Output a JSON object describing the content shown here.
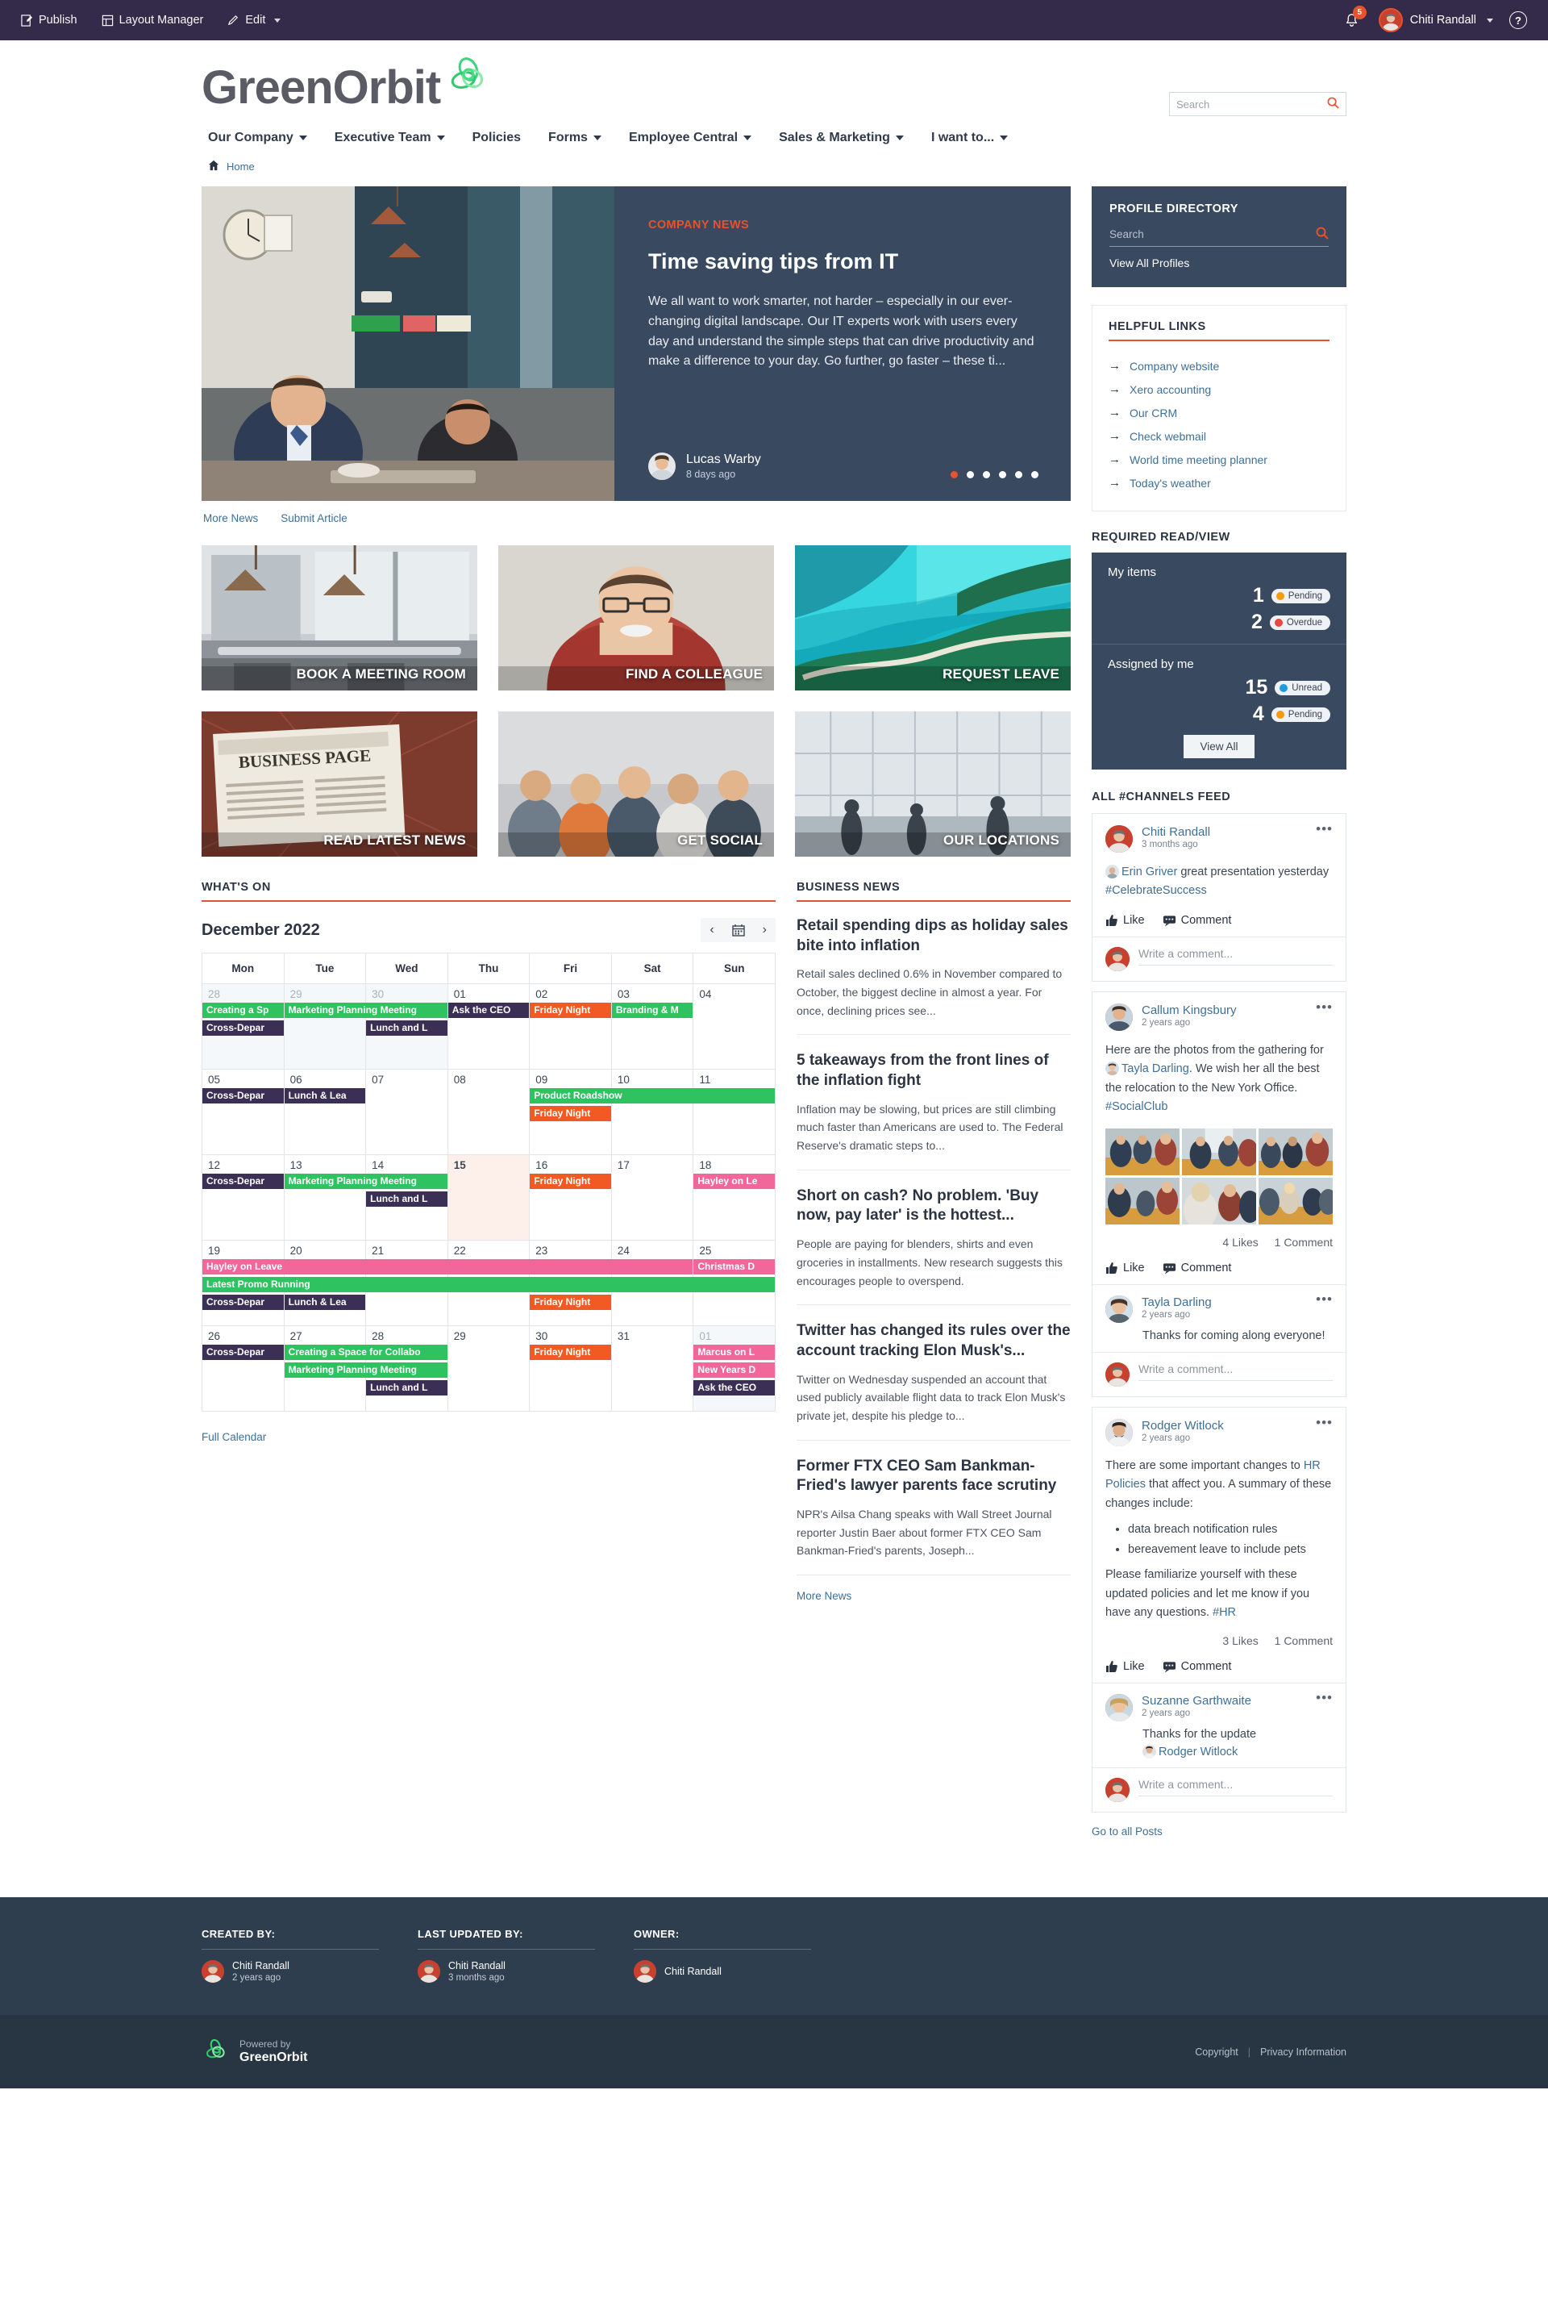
{
  "admin_bar": {
    "publish": "Publish",
    "layout_manager": "Layout Manager",
    "edit": "Edit",
    "notification_count": "5",
    "user_name": "Chiti Randall",
    "help": "?"
  },
  "header": {
    "logo_text": "GreenOrbit",
    "search_placeholder": "Search"
  },
  "nav": {
    "items": [
      {
        "label": "Our Company",
        "caret": true
      },
      {
        "label": "Executive Team",
        "caret": true
      },
      {
        "label": "Policies",
        "caret": false
      },
      {
        "label": "Forms",
        "caret": true
      },
      {
        "label": "Employee Central",
        "caret": true
      },
      {
        "label": "Sales & Marketing",
        "caret": true
      },
      {
        "label": "I want to...",
        "caret": true
      }
    ]
  },
  "breadcrumb": {
    "home": "Home"
  },
  "hero": {
    "kicker": "COMPANY NEWS",
    "title": "Time saving tips from IT",
    "body": "We all want to work smarter, not harder – especially in our ever-changing digital landscape. Our IT experts work with users every day and understand the simple steps that can drive productivity and make a difference to your day. Go further, go faster – these ti...",
    "author": "Lucas Warby",
    "time": "8 days ago",
    "dots_total": 6,
    "dot_active": 0,
    "more_news": "More News",
    "submit_article": "Submit Article"
  },
  "tiles": [
    {
      "label": "BOOK A MEETING ROOM",
      "name": "tile-book-a-meeting-room"
    },
    {
      "label": "FIND A COLLEAGUE",
      "name": "tile-find-a-colleague"
    },
    {
      "label": "REQUEST LEAVE",
      "name": "tile-request-leave"
    },
    {
      "label": "READ LATEST NEWS",
      "name": "tile-read-latest-news"
    },
    {
      "label": "GET SOCIAL",
      "name": "tile-get-social"
    },
    {
      "label": "OUR LOCATIONS",
      "name": "tile-our-locations"
    }
  ],
  "calendar": {
    "widget_title": "WHAT'S ON",
    "month": "December 2022",
    "prev": "‹",
    "next": "›",
    "daynames": [
      "Mon",
      "Tue",
      "Wed",
      "Thu",
      "Fri",
      "Sat",
      "Sun"
    ],
    "full_calendar": "Full Calendar",
    "weeks": [
      [
        {
          "num": "28",
          "muted": true,
          "events": [
            {
              "t": "Creating a Sp",
              "c": "green"
            },
            {
              "t": "Cross-Depar",
              "c": "purple"
            }
          ]
        },
        {
          "num": "29",
          "muted": true,
          "events": [
            {
              "t": "Marketing Planning Meeting",
              "c": "green",
              "span": 2
            }
          ]
        },
        {
          "num": "30",
          "muted": true,
          "events": [
            {
              "t": "",
              "c": "spacer"
            },
            {
              "t": "Lunch and L",
              "c": "purple"
            }
          ]
        },
        {
          "num": "01",
          "muted": false,
          "events": [
            {
              "t": "Ask the CEO",
              "c": "purple"
            }
          ]
        },
        {
          "num": "02",
          "muted": false,
          "events": [
            {
              "t": "Friday Night",
              "c": "orange"
            }
          ]
        },
        {
          "num": "03",
          "muted": false,
          "events": [
            {
              "t": "Branding & M",
              "c": "green"
            }
          ]
        },
        {
          "num": "04",
          "muted": false,
          "events": []
        }
      ],
      [
        {
          "num": "05",
          "muted": false,
          "events": [
            {
              "t": "Cross-Depar",
              "c": "purple"
            }
          ]
        },
        {
          "num": "06",
          "muted": false,
          "events": [
            {
              "t": "Lunch & Lea",
              "c": "purple"
            }
          ]
        },
        {
          "num": "07",
          "muted": false,
          "events": []
        },
        {
          "num": "08",
          "muted": false,
          "events": []
        },
        {
          "num": "09",
          "muted": false,
          "events": [
            {
              "t": "Product Roadshow",
              "c": "green",
              "span": 3
            },
            {
              "t": "Friday Night",
              "c": "orange"
            }
          ]
        },
        {
          "num": "10",
          "muted": false,
          "events": []
        },
        {
          "num": "11",
          "muted": false,
          "events": []
        }
      ],
      [
        {
          "num": "12",
          "muted": false,
          "events": [
            {
              "t": "Cross-Depar",
              "c": "purple"
            }
          ]
        },
        {
          "num": "13",
          "muted": false,
          "events": [
            {
              "t": "Marketing Planning Meeting",
              "c": "green",
              "span": 2
            }
          ]
        },
        {
          "num": "14",
          "muted": false,
          "events": [
            {
              "t": "",
              "c": "spacer"
            },
            {
              "t": "Lunch and L",
              "c": "purple"
            }
          ]
        },
        {
          "num": "15",
          "muted": false,
          "today": true,
          "events": []
        },
        {
          "num": "16",
          "muted": false,
          "events": [
            {
              "t": "Friday Night",
              "c": "orange"
            }
          ]
        },
        {
          "num": "17",
          "muted": false,
          "events": []
        },
        {
          "num": "18",
          "muted": false,
          "events": [
            {
              "t": "Hayley on Le",
              "c": "pink"
            }
          ]
        }
      ],
      [
        {
          "num": "19",
          "muted": false,
          "events": [
            {
              "t": "Hayley on Leave",
              "c": "pink",
              "span": 6
            },
            {
              "t": "Latest Promo Running",
              "c": "green",
              "span": 7
            },
            {
              "t": "Cross-Depar",
              "c": "purple"
            }
          ]
        },
        {
          "num": "20",
          "muted": false,
          "events": [
            {
              "t": "",
              "c": "spacer"
            },
            {
              "t": "",
              "c": "spacer"
            },
            {
              "t": "Lunch & Lea",
              "c": "purple"
            }
          ]
        },
        {
          "num": "21",
          "muted": false,
          "events": []
        },
        {
          "num": "22",
          "muted": false,
          "events": []
        },
        {
          "num": "23",
          "muted": false,
          "events": [
            {
              "t": "",
              "c": "spacer"
            },
            {
              "t": "",
              "c": "spacer"
            },
            {
              "t": "Friday Night",
              "c": "orange"
            }
          ]
        },
        {
          "num": "24",
          "muted": false,
          "events": []
        },
        {
          "num": "25",
          "muted": false,
          "events": [
            {
              "t": "Christmas D",
              "c": "pink"
            }
          ]
        }
      ],
      [
        {
          "num": "26",
          "muted": false,
          "events": [
            {
              "t": "Cross-Depar",
              "c": "purple"
            }
          ]
        },
        {
          "num": "27",
          "muted": false,
          "events": [
            {
              "t": "Creating a Space for Collabo",
              "c": "green",
              "span": 2
            },
            {
              "t": "Marketing Planning Meeting",
              "c": "green",
              "span": 2
            }
          ]
        },
        {
          "num": "28",
          "muted": false,
          "events": [
            {
              "t": "",
              "c": "spacer"
            },
            {
              "t": "",
              "c": "spacer"
            },
            {
              "t": "Lunch and L",
              "c": "purple"
            }
          ]
        },
        {
          "num": "29",
          "muted": false,
          "events": []
        },
        {
          "num": "30",
          "muted": false,
          "events": [
            {
              "t": "Friday Night",
              "c": "orange"
            }
          ]
        },
        {
          "num": "31",
          "muted": false,
          "events": []
        },
        {
          "num": "01",
          "muted": true,
          "events": [
            {
              "t": "Marcus on L",
              "c": "pink"
            },
            {
              "t": "New Years D",
              "c": "pink"
            },
            {
              "t": "Ask the CEO",
              "c": "purple"
            }
          ]
        }
      ]
    ]
  },
  "business_news": {
    "widget_title": "BUSINESS NEWS",
    "more": "More News",
    "items": [
      {
        "title": "Retail spending dips as holiday sales bite into inflation",
        "snippet": "Retail sales declined 0.6% in November compared to October, the biggest decline in almost a year. For once, declining prices see..."
      },
      {
        "title": "5 takeaways from the front lines of the inflation fight",
        "snippet": "Inflation may be slowing, but prices are still climbing much faster than Americans are used to. The Federal Reserve's dramatic steps to..."
      },
      {
        "title": "Short on cash? No problem. 'Buy now, pay later' is the hottest...",
        "snippet": "People are paying for blenders, shirts and even groceries in installments. New research suggests this encourages people to overspend."
      },
      {
        "title": "Twitter has changed its rules over the account tracking Elon Musk's...",
        "snippet": "Twitter on Wednesday suspended an account that used publicly available flight data to track Elon Musk's private jet, despite his pledge to..."
      },
      {
        "title": "Former FTX CEO Sam Bankman-Fried's lawyer parents face scrutiny",
        "snippet": "NPR's Ailsa Chang speaks with Wall Street Journal reporter Justin Baer about former FTX CEO Sam Bankman-Fried's parents, Joseph..."
      }
    ]
  },
  "profile_directory": {
    "title": "PROFILE DIRECTORY",
    "search_placeholder": "Search",
    "view_all": "View All Profiles"
  },
  "helpful_links": {
    "title": "HELPFUL LINKS",
    "items": [
      "Company website",
      "Xero accounting",
      "Our CRM",
      "Check webmail",
      "World time meeting planner",
      "Today's weather"
    ]
  },
  "required_read": {
    "title": "REQUIRED READ/VIEW",
    "my_items_label": "My items",
    "my_items": [
      {
        "count": "1",
        "status": "Pending",
        "color": "#f59b11"
      },
      {
        "count": "2",
        "status": "Overdue",
        "color": "#e8483f"
      }
    ],
    "assigned_label": "Assigned by me",
    "assigned": [
      {
        "count": "15",
        "status": "Unread",
        "color": "#1f9bde"
      },
      {
        "count": "4",
        "status": "Pending",
        "color": "#f59b11"
      }
    ],
    "view_all": "View All"
  },
  "feed": {
    "title": "ALL #CHANNELS FEED",
    "like_label": "Like",
    "comment_label": "Comment",
    "comment_placeholder": "Write a comment...",
    "goto_all": "Go to all Posts",
    "posts": [
      {
        "author": "Chiti Randall",
        "time": "3 months ago",
        "mention": "Erin Griver",
        "body_after": " great presentation yesterday ",
        "hashtag": "#CelebrateSuccess",
        "menu": "•••"
      },
      {
        "author": "Callum Kingsbury",
        "time": "2 years ago",
        "body_pre": "Here are the photos from the gathering for ",
        "mention": "Tayla Darling",
        "body_after": ". We wish her all the best the relocation to the New York Office. ",
        "hashtag": "#SocialClub",
        "likes": "4 Likes",
        "comments": "1 Comment",
        "comment_author": "Tayla Darling",
        "comment_time": "2 years ago",
        "comment_text": "Thanks for coming along everyone!",
        "menu": "•••"
      },
      {
        "author": "Rodger Witlock",
        "time": "2 years ago",
        "body_pre": "There are some important changes to ",
        "link": "HR Policies",
        "body_after": " that affect you. A summary of these changes include:",
        "bullets": [
          "data breach notification rules",
          "bereavement leave to include pets"
        ],
        "body_tail": "Please familiarize yourself with these updated policies and let me know if you have any questions. ",
        "hashtag": "#HR",
        "likes": "3 Likes",
        "comments": "1 Comment",
        "comment_author": "Suzanne Garthwaite",
        "comment_time": "2 years ago",
        "comment_text": "Thanks for the update",
        "comment_mention": "Rodger Witlock",
        "menu": "•••"
      }
    ]
  },
  "footer": {
    "created_by_label": "CREATED BY:",
    "created_by_name": "Chiti Randall",
    "created_by_time": "2 years ago",
    "last_updated_label": "LAST UPDATED BY:",
    "last_updated_name": "Chiti Randall",
    "last_updated_time": "3 months ago",
    "owner_label": "OWNER:",
    "owner_name": "Chiti Randall",
    "powered_by": "Powered by",
    "brand": "GreenOrbit",
    "copyright": "Copyright",
    "privacy": "Privacy Information"
  },
  "colors": {
    "accent": "#e8522c",
    "navy": "#384960",
    "admin": "#342b4a",
    "green": "#2ec360",
    "link": "#3f6f96"
  }
}
